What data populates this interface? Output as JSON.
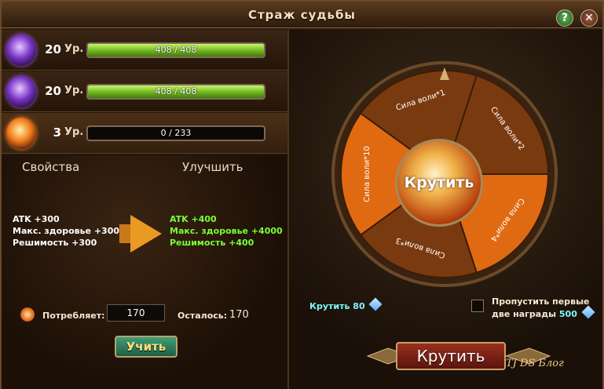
{
  "window": {
    "title": "Страж судьбы",
    "help": "?",
    "close": "✕"
  },
  "rows": [
    {
      "level": "20",
      "unit": "Ур.",
      "progress_text": "408 / 408",
      "progress": 1.0,
      "gem": "purple-gem-icon"
    },
    {
      "level": "20",
      "unit": "Ур.",
      "progress_text": "408 / 408",
      "progress": 1.0,
      "gem": "purple-gem-icon"
    },
    {
      "level": "3",
      "unit": "Ур.",
      "progress_text": "0 / 233",
      "progress": 0.0,
      "gem": "orange-gem-icon"
    }
  ],
  "properties": {
    "header_left": "Свойства",
    "header_right": "Улучшить",
    "current": [
      "ATK +300",
      "Макс. здоровье +3000",
      "Решимость +300"
    ],
    "upgraded": [
      "ATK +400",
      "Макс. здоровье +4000",
      "Решимость +400"
    ],
    "consume_label": "Потребляет:",
    "consume_value": "170",
    "remain_label": "Осталось:",
    "remain_value": "170",
    "learn_button": "Учить"
  },
  "wheel": {
    "center_label": "Крутить",
    "segments": [
      "Сила воли*2",
      "Сила воли*4",
      "Сила воли*3",
      "Сила воли*10",
      "Сила воли*1"
    ],
    "spin_cost_label": "Крутить",
    "spin_cost_value": "80",
    "skip_label_line1": "Пропустить первые",
    "skip_label_line2": "две награды",
    "skip_cost": "500",
    "spin_button": "Крутить"
  },
  "watermark": "TJ DS Блог",
  "colors": {
    "accent_green": "#7cff3a",
    "accent_cyan": "#7cf5ff",
    "segment_dark": "#7a3a10",
    "segment_light": "#e06a12"
  }
}
